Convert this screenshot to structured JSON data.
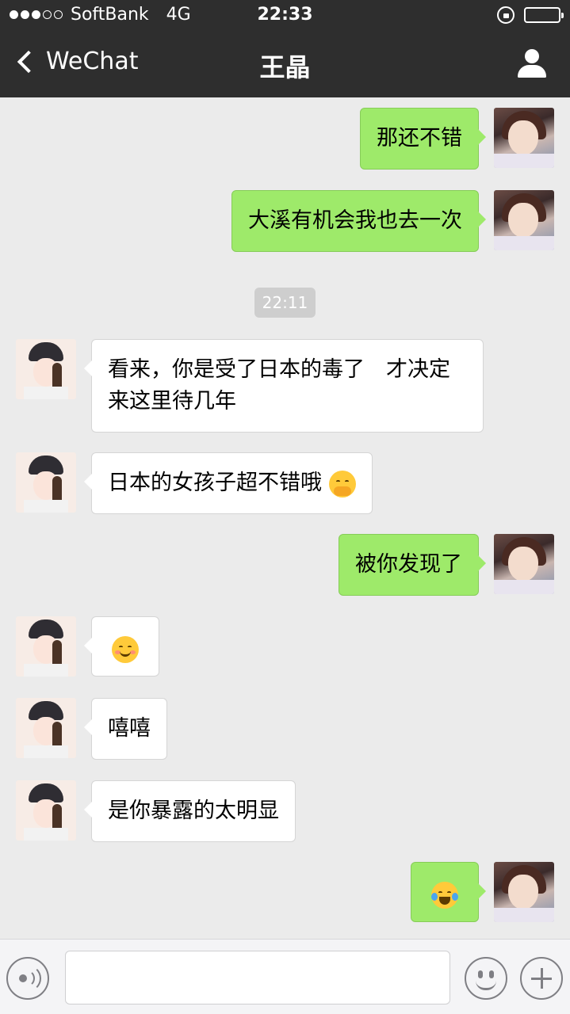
{
  "status_bar": {
    "carrier": "SoftBank",
    "network": "4G",
    "time": "22:33",
    "signal_dots_filled": 3,
    "signal_dots_total": 5
  },
  "nav": {
    "back_label": "WeChat",
    "title": "王晶",
    "profile_icon": "person-icon"
  },
  "colors": {
    "nav_background": "#2e2e2e",
    "chat_background": "#ebebeb",
    "outgoing_bubble": "#9eea6a",
    "incoming_bubble": "#ffffff",
    "timestamp_pill": "#cecece"
  },
  "messages": [
    {
      "sender": "me",
      "text": "那还不错"
    },
    {
      "sender": "me",
      "text": "大溪有机会我也去一次"
    },
    {
      "type": "timestamp",
      "text": "22:11"
    },
    {
      "sender": "other",
      "text_line1": "看来，你是受了日本的毒了　才决定",
      "text_line2": "来这里待几年"
    },
    {
      "sender": "other",
      "text": "日本的女孩子超不错哦",
      "emoji": "giggle-emoji"
    },
    {
      "sender": "me",
      "text": "被你发现了"
    },
    {
      "sender": "other",
      "emoji": "smile-emoji"
    },
    {
      "sender": "other",
      "text": "嘻嘻"
    },
    {
      "sender": "other",
      "text": "是你暴露的太明显"
    },
    {
      "sender": "me",
      "emoji": "laughing-tears-emoji"
    }
  ],
  "input_bar": {
    "voice_icon": "voice-icon",
    "text_value": "",
    "emoji_icon": "emoji-icon",
    "plus_icon": "plus-icon"
  }
}
